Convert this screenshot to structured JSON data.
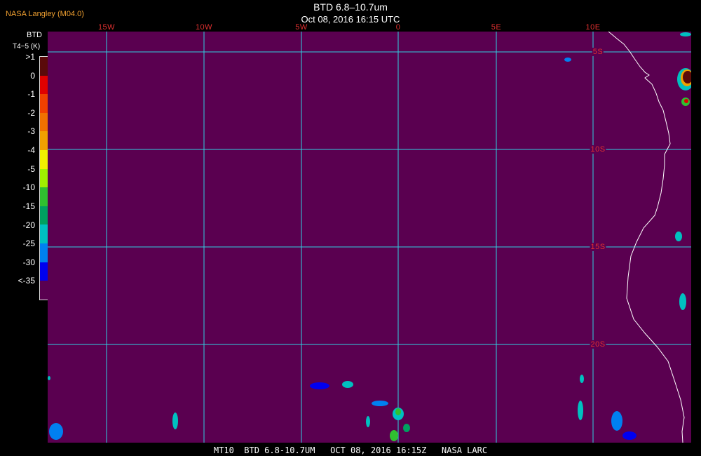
{
  "header": {
    "credit": "NASA Langley (M04.0)",
    "title": "BTD 6.8–10.7um",
    "subtitle": "Oct 08, 2016 16:15 UTC"
  },
  "legend": {
    "title": "BTD",
    "unit": "T4−5 (K)",
    "items": [
      {
        "label": ">1",
        "color": "#5a0a0a"
      },
      {
        "label": "0",
        "color": "#e00000"
      },
      {
        "label": "-1",
        "color": "#f04000"
      },
      {
        "label": "-2",
        "color": "#f07000"
      },
      {
        "label": "-3",
        "color": "#f0a000"
      },
      {
        "label": "-4",
        "color": "#f0f000"
      },
      {
        "label": "-5",
        "color": "#a0f000"
      },
      {
        "label": "-10",
        "color": "#30c030"
      },
      {
        "label": "-15",
        "color": "#00a060"
      },
      {
        "label": "-20",
        "color": "#00c0c0"
      },
      {
        "label": "-25",
        "color": "#0080f0"
      },
      {
        "label": "-30",
        "color": "#0000f0"
      },
      {
        "label": "<-35",
        "color": "#5a0050"
      }
    ]
  },
  "grid": {
    "lon_labels": [
      "15W",
      "10W",
      "5W",
      "0",
      "5E",
      "10E"
    ],
    "lat_labels": [
      "5S",
      "10S",
      "15S",
      "20S"
    ],
    "line_color": "#30d0e0"
  },
  "footer": {
    "text": "MT10  BTD 6.8-10.7UM   OCT 08, 2016 16:15Z   NASA LARC"
  }
}
